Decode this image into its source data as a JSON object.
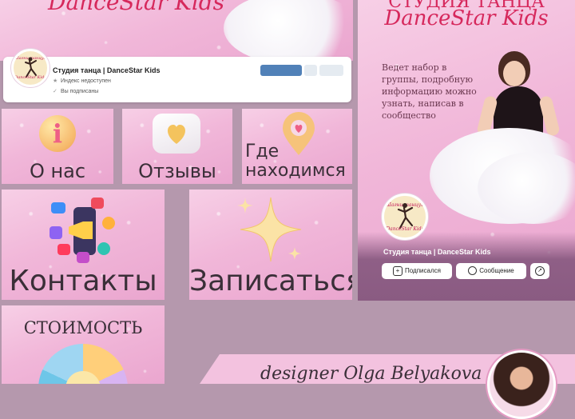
{
  "cover": {
    "title": "DanceStar Kids",
    "avatar_logo_line1": "Шагни танцуй",
    "avatar_logo_line2": "DanceStar Kids"
  },
  "profile_card": {
    "name": "Студия танца | DanceStar Kids",
    "line1": "Индекс недоступен",
    "line2": "Вы подписаны",
    "accent_color": "#5181b8"
  },
  "tiles": {
    "about": "О нас",
    "reviews": "Отзывы",
    "location_line1": "Где",
    "location_line2": "находимся",
    "contacts": "Контакты",
    "signup": "Записаться",
    "price": "СТОИМОСТЬ"
  },
  "mobile": {
    "studio": "СТУДИЯ ТАНЦА",
    "title": "DanceStar Kids",
    "text": "Ведет набор в группы, подробную информацию можно узнать, написав в сообщество",
    "name": "Студия танца | DanceStar Kids",
    "subscribed_button": "Подписался",
    "message_button": "Сообщение"
  },
  "banner": {
    "text": "designer Olga Belyakova"
  },
  "colors": {
    "background": "#b598ad",
    "pink": "#f1b7d9",
    "brand_red": "#d6285c"
  }
}
